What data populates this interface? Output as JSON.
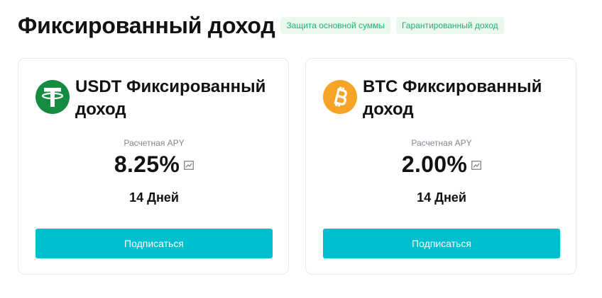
{
  "header": {
    "title": "Фиксированный доход",
    "badges": [
      "Защита основной суммы",
      "Гарантированный доход"
    ]
  },
  "colors": {
    "accent": "#00c0cf",
    "badge_bg": "#eaf8ef",
    "badge_text": "#20b26c",
    "usdt": "#168c41",
    "btc": "#f7a325"
  },
  "products": [
    {
      "icon": "usdt-icon",
      "title": "USDT Фиксированный доход",
      "apy_label": "Расчетная APY",
      "apy": "8.25%",
      "term": "14 Дней",
      "button": "Подписаться"
    },
    {
      "icon": "btc-icon",
      "title": "BTC Фиксированный доход",
      "apy_label": "Расчетная APY",
      "apy": "2.00%",
      "term": "14 Дней",
      "button": "Подписаться"
    }
  ]
}
